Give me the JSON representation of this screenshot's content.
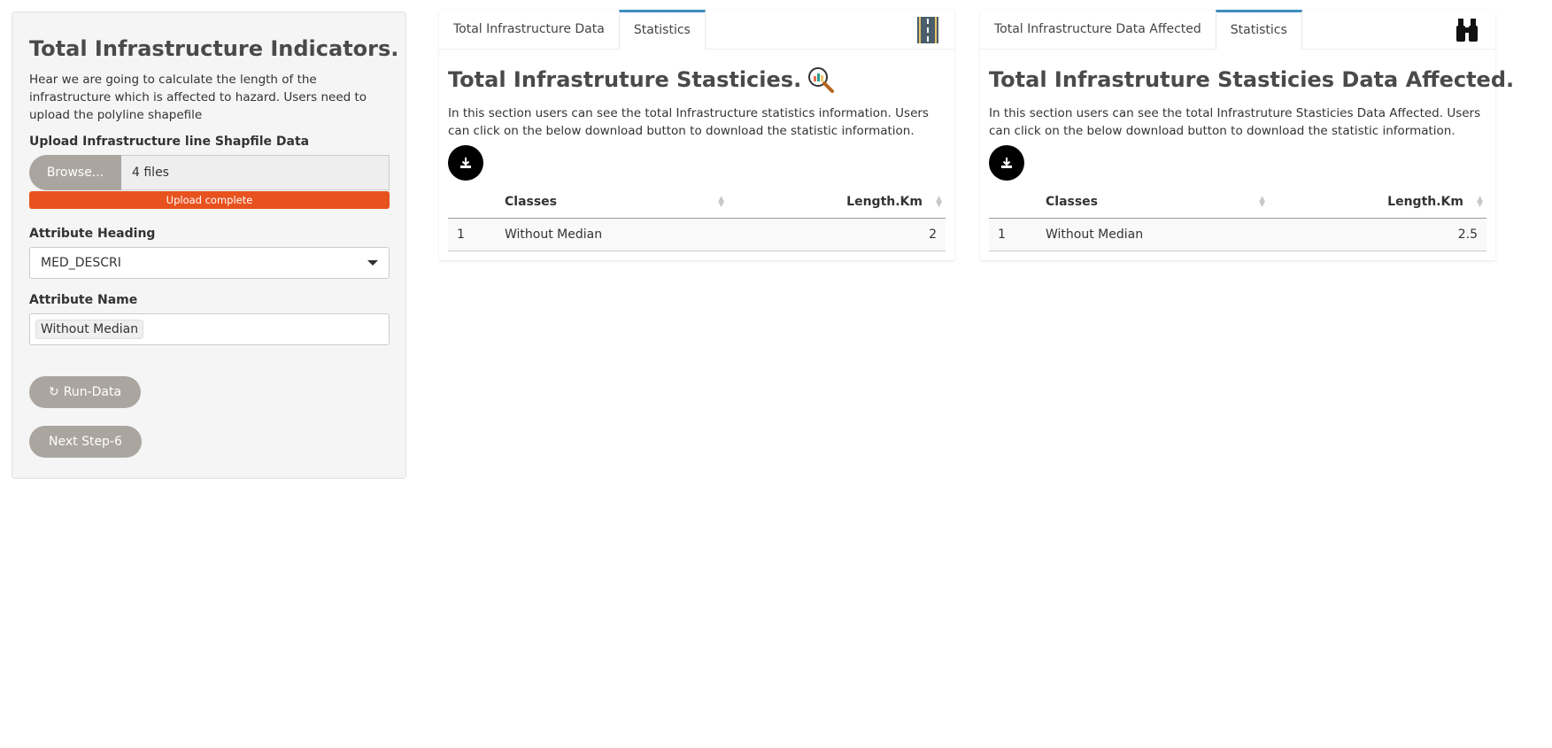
{
  "sidebar": {
    "title": "Total Infrastructure Indicators.",
    "description": "Hear we are going to calculate the length of the infrastructure which is affected to hazard. Users need to upload the polyline shapefile",
    "upload_label": "Upload Infrastructure line Shapfile Data",
    "browse_label": "Browse...",
    "file_value": "4 files",
    "progress_text": "Upload complete",
    "progress_fraction": 1.0,
    "heading_label": "Attribute Heading",
    "heading_value": "MED_DESCRI",
    "name_label": "Attribute Name",
    "name_value": "Without Median",
    "run_label": "Run-Data",
    "next_label": "Next Step-6"
  },
  "panel1": {
    "tab1": "Total Infrastructure Data",
    "tab2": "Statistics",
    "title": "Total Infrastruture Stasticies.",
    "description": "In this section users can see the total Infrastructure statistics information. Users can click on the below download button to download the statistic information.",
    "col_classes": "Classes",
    "col_length": "Length.Km",
    "row": {
      "index": "1",
      "classes": "Without Median",
      "length": "2"
    },
    "icon": "road-icon"
  },
  "panel2": {
    "tab1": "Total Infrastructure Data Affected",
    "tab2": "Statistics",
    "title": "Total Infrastruture Stasticies Data Affected.",
    "description": "In this section users can see the total Infrastruture Stasticies Data Affected. Users can click on the below download button to download the statistic information.",
    "col_classes": "Classes",
    "col_length": "Length.Km",
    "row": {
      "index": "1",
      "classes": "Without Median",
      "length": "2.5"
    },
    "icon": "binoculars-icon"
  },
  "colors": {
    "accent": "#3c8dbc",
    "progress": "#e8521f",
    "button": "#aba5a0"
  }
}
